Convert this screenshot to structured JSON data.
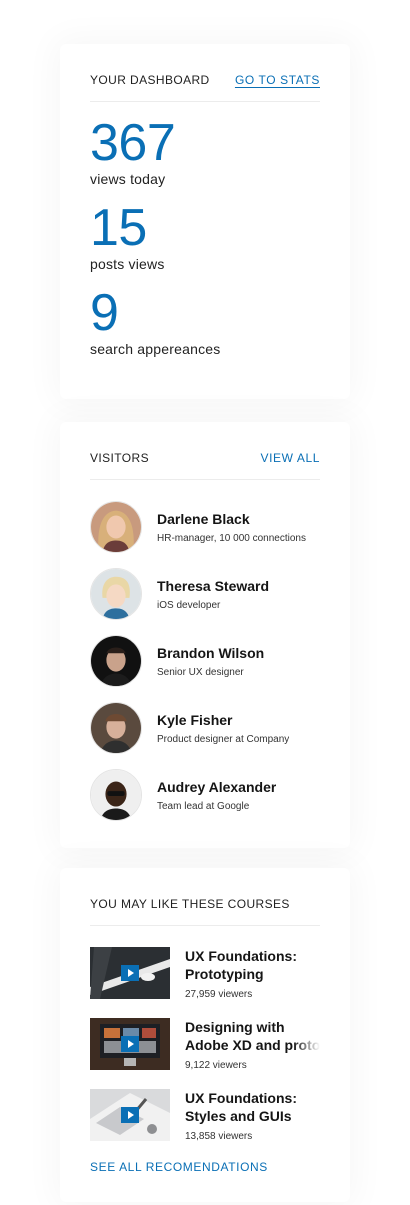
{
  "dashboard": {
    "title": "YOUR DASHBOARD",
    "link": "GO TO STATS",
    "stats": [
      {
        "value": "367",
        "label": "views today"
      },
      {
        "value": "15",
        "label": "posts views"
      },
      {
        "value": "9",
        "label": "search appereances"
      }
    ]
  },
  "visitors": {
    "title": "VISITORS",
    "link": "VIEW ALL",
    "items": [
      {
        "name": "Darlene Black",
        "role": "HR-manager, 10 000 connections"
      },
      {
        "name": "Theresa Steward",
        "role": "iOS developer"
      },
      {
        "name": "Brandon Wilson",
        "role": "Senior UX designer"
      },
      {
        "name": "Kyle Fisher",
        "role": "Product designer at Company"
      },
      {
        "name": "Audrey Alexander",
        "role": "Team lead at Google"
      }
    ]
  },
  "courses": {
    "title": "YOU MAY LIKE THESE COURSES",
    "items": [
      {
        "title_line1": "UX Foundations:",
        "title_line2": "Prototyping",
        "viewers": "27,959 viewers"
      },
      {
        "title_line1": "Designing with",
        "title_line2": "Adobe XD and prototyping",
        "viewers": "9,122 viewers"
      },
      {
        "title_line1": "UX Foundations:",
        "title_line2": "Styles and GUIs",
        "viewers": "13,858 viewers"
      }
    ],
    "see_all": "SEE ALL RECOMENDATIONS"
  },
  "colors": {
    "accent": "#0a6fb5",
    "text": "#1a1a1a",
    "divider": "#ececec"
  }
}
